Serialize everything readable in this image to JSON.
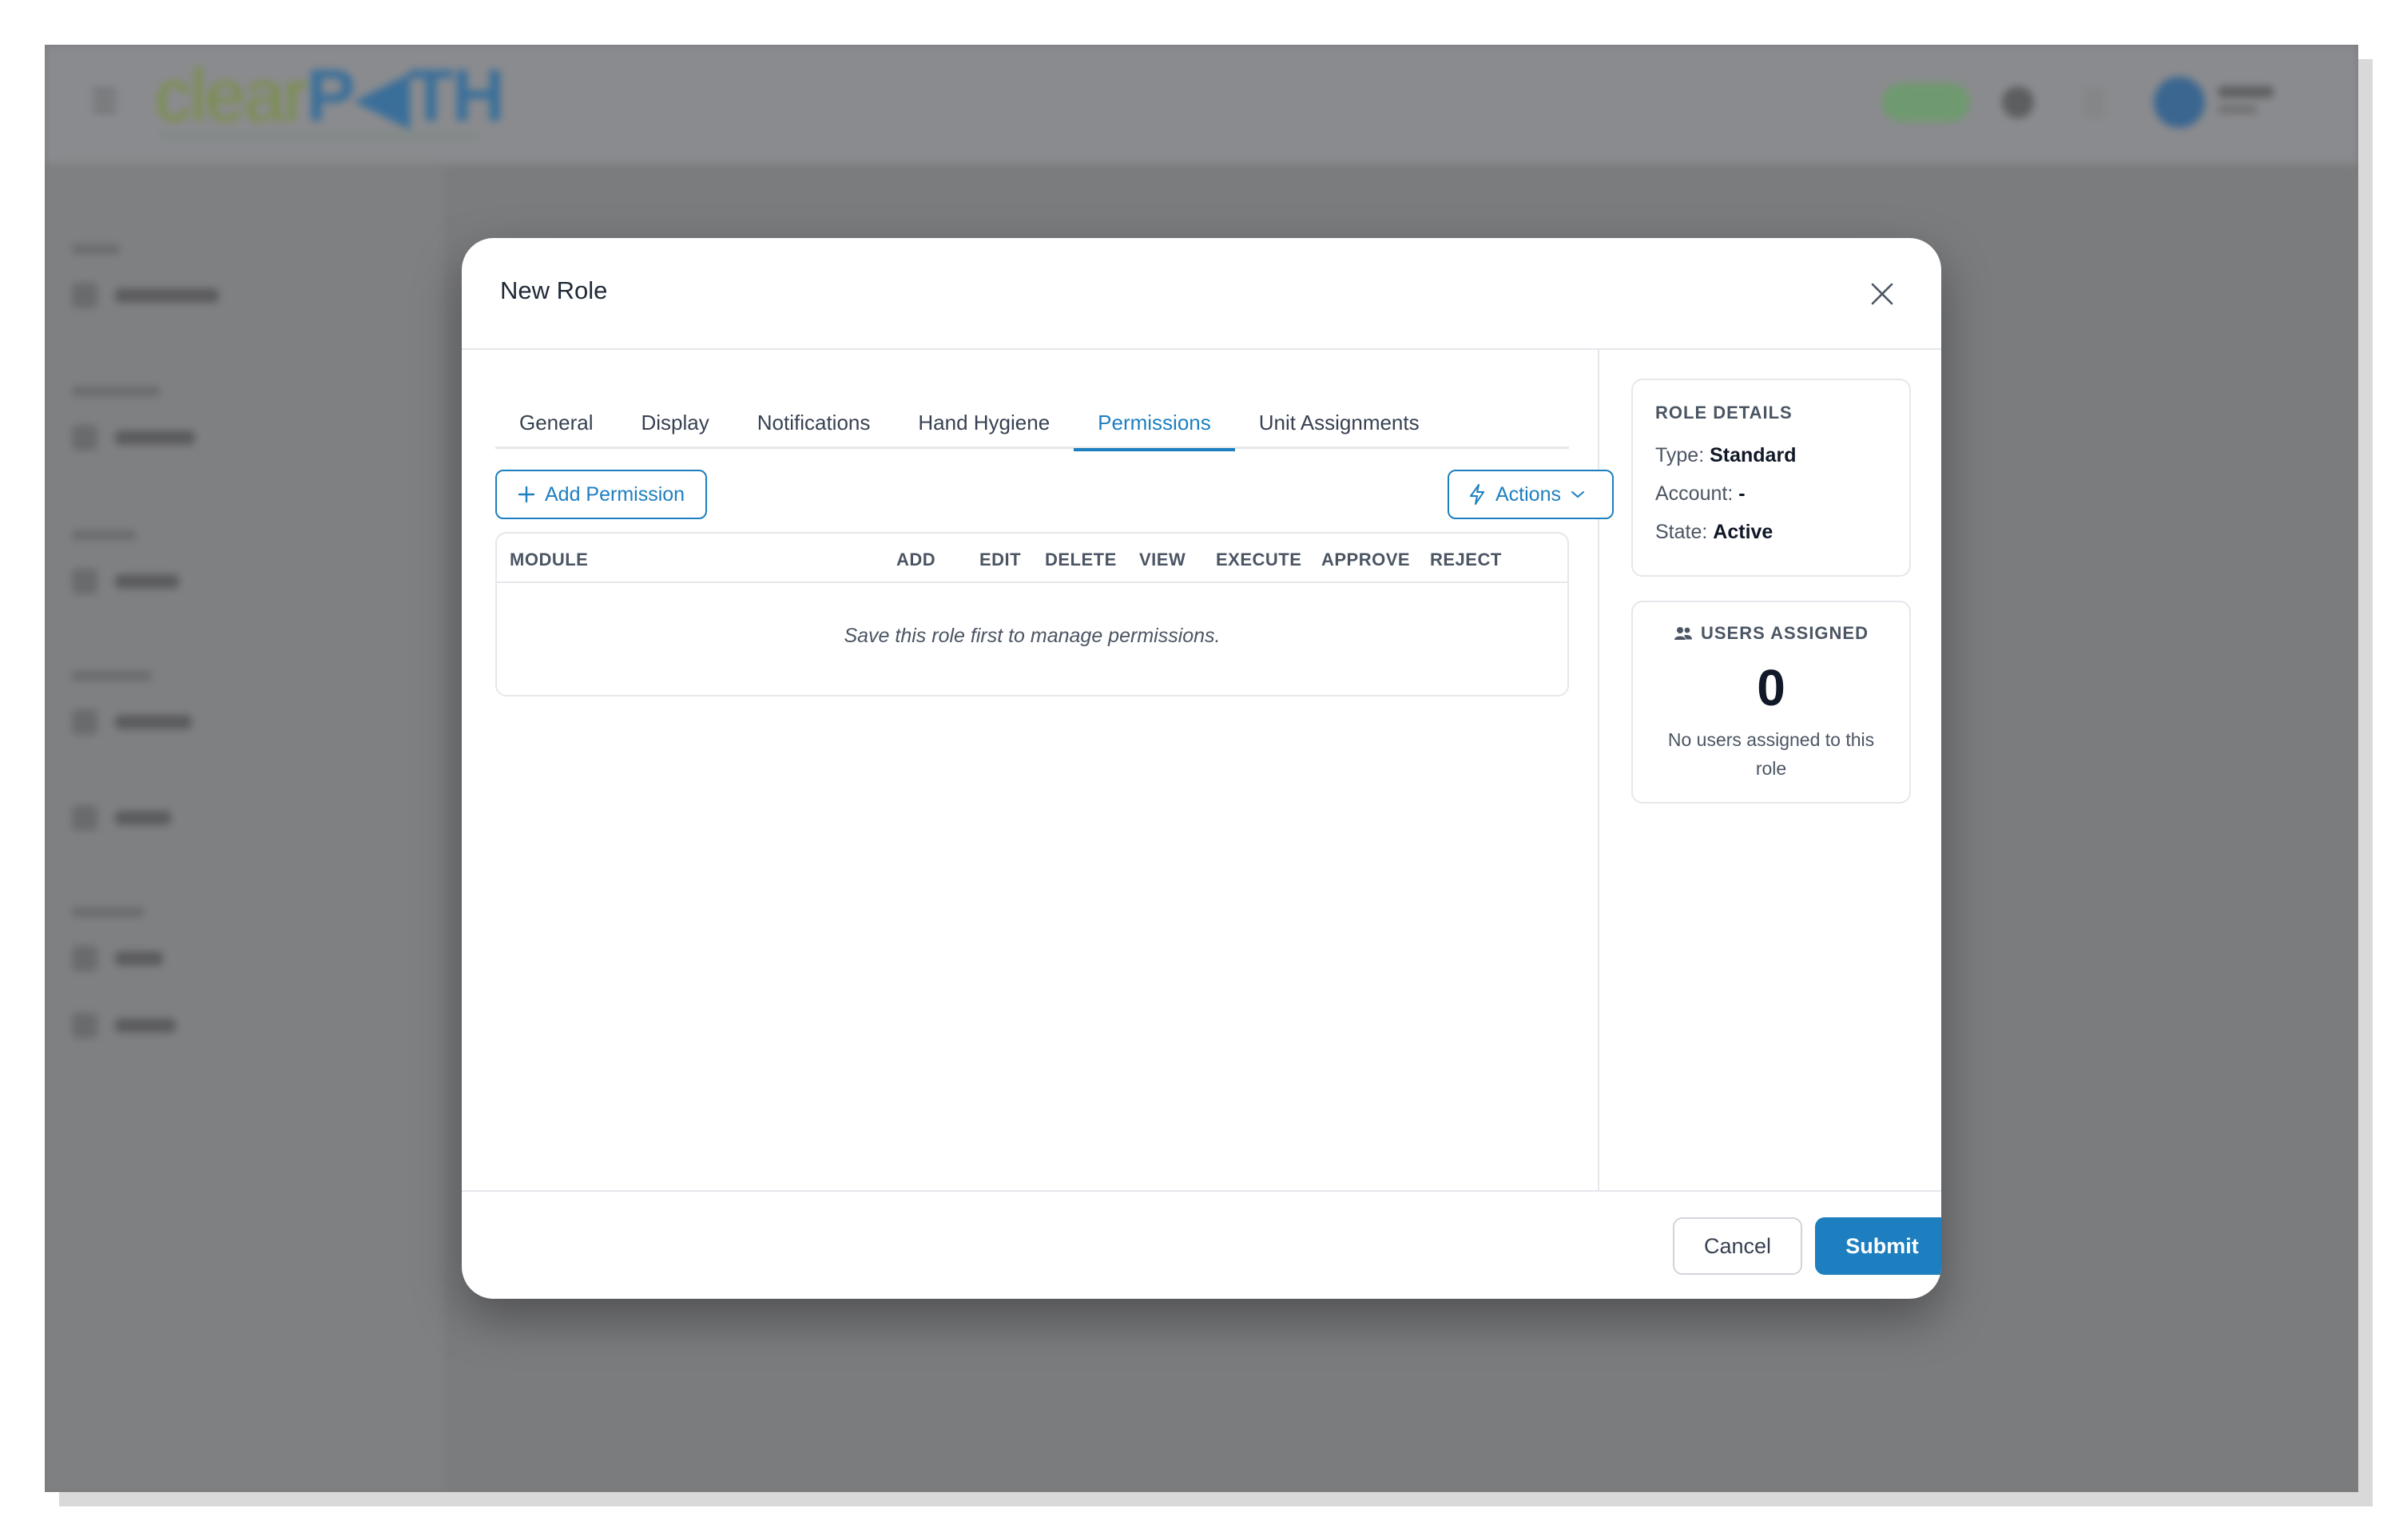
{
  "background_app": {
    "logo": {
      "part1": "clear",
      "part2": "P◀TH"
    }
  },
  "modal": {
    "title": "New Role",
    "close_icon": "close-icon",
    "tabs": [
      {
        "label": "General",
        "active": false
      },
      {
        "label": "Display",
        "active": false
      },
      {
        "label": "Notifications",
        "active": false
      },
      {
        "label": "Hand Hygiene",
        "active": false
      },
      {
        "label": "Permissions",
        "active": true
      },
      {
        "label": "Unit Assignments",
        "active": false
      }
    ],
    "toolbar": {
      "add_permission_label": "Add Permission",
      "add_permission_icon": "plus-icon",
      "actions_label": "Actions",
      "actions_icon": "lightning-icon",
      "actions_chevron": "chevron-down-icon"
    },
    "permissions_table": {
      "columns": [
        "MODULE",
        "ADD",
        "EDIT",
        "DELETE",
        "VIEW",
        "EXECUTE",
        "APPROVE",
        "REJECT"
      ],
      "empty_message": "Save this role first to manage permissions."
    },
    "role_details": {
      "title": "ROLE DETAILS",
      "type_label": "Type:",
      "type_value": "Standard",
      "account_label": "Account:",
      "account_value": "-",
      "state_label": "State:",
      "state_value": "Active"
    },
    "users_assigned": {
      "title": "USERS ASSIGNED",
      "icon": "users-icon",
      "count": "0",
      "description": "No users assigned to this role"
    },
    "footer": {
      "cancel_label": "Cancel",
      "submit_label": "Submit"
    }
  },
  "colors": {
    "accent": "#1d7fc0",
    "overlay": "#7b7c7e",
    "text_primary": "#111827",
    "text_secondary": "#4b5563",
    "border": "#e5e7eb"
  }
}
